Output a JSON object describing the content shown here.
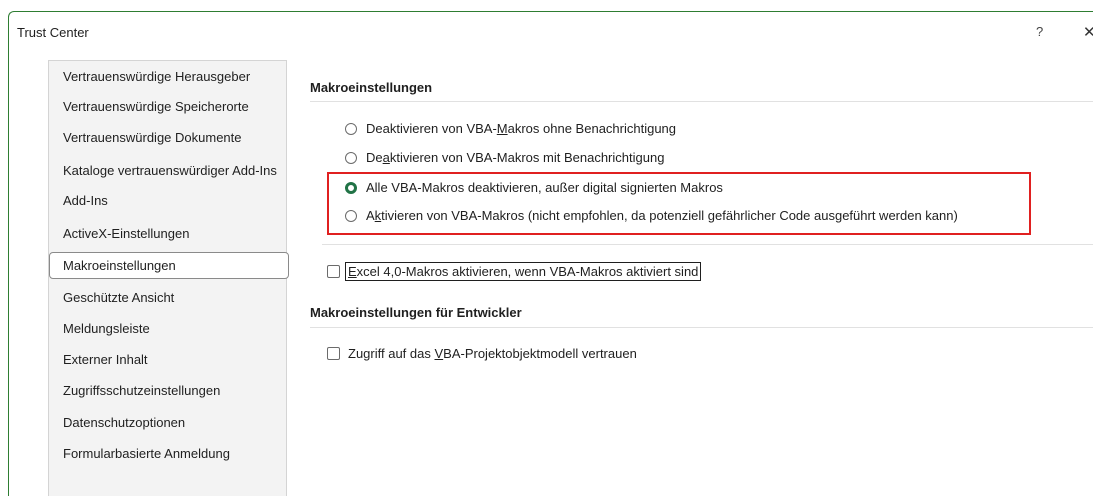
{
  "window": {
    "title": "Trust Center",
    "help_label": "?",
    "close_label": "✕"
  },
  "sidebar": {
    "items": [
      {
        "label": "Vertrauenswürdige Herausgeber"
      },
      {
        "label": "Vertrauenswürdige Speicherorte"
      },
      {
        "label": "Vertrauenswürdige Dokumente"
      },
      {
        "label": "Kataloge vertrauenswürdiger Add-Ins"
      },
      {
        "label": "Add-Ins"
      },
      {
        "label": "ActiveX-Einstellungen"
      },
      {
        "label": "Makroeinstellungen",
        "selected": true
      },
      {
        "label": "Geschützte Ansicht"
      },
      {
        "label": "Meldungsleiste"
      },
      {
        "label": "Externer Inhalt"
      },
      {
        "label": "Zugriffsschutzeinstellungen"
      },
      {
        "label": "Datenschutzoptionen"
      },
      {
        "label": "Formularbasierte Anmeldung"
      }
    ]
  },
  "macro_settings": {
    "title": "Makroeinstellungen",
    "options": [
      {
        "pre": "Deaktivieren von VBA-",
        "ul": "M",
        "post": "akros ohne Benachrichtigung",
        "checked": false
      },
      {
        "pre": "De",
        "ul": "a",
        "post": "ktivieren von VBA-Makros mit Benachrichtigung",
        "checked": false
      },
      {
        "pre": "Alle VBA-Makros deaktivieren, außer digital signierten Makros",
        "ul": "",
        "post": "",
        "checked": true
      },
      {
        "pre": "A",
        "ul": "k",
        "post": "tivieren von VBA-Makros (nicht empfohlen, da potenziell gefährlicher Code ausgeführt werden kann)",
        "checked": false
      }
    ],
    "excel4": {
      "ul": "E",
      "post": "xcel 4,0-Makros aktivieren, wenn VBA-Makros aktiviert sind",
      "checked": false
    }
  },
  "developer": {
    "title": "Makroeinstellungen für Entwickler",
    "trust_vba": {
      "pre": "Zugriff auf das ",
      "ul": "V",
      "post": "BA-Projektobjektmodell vertrauen",
      "checked": false
    }
  },
  "colors": {
    "accent": "#217346",
    "highlight": "#e02020"
  }
}
